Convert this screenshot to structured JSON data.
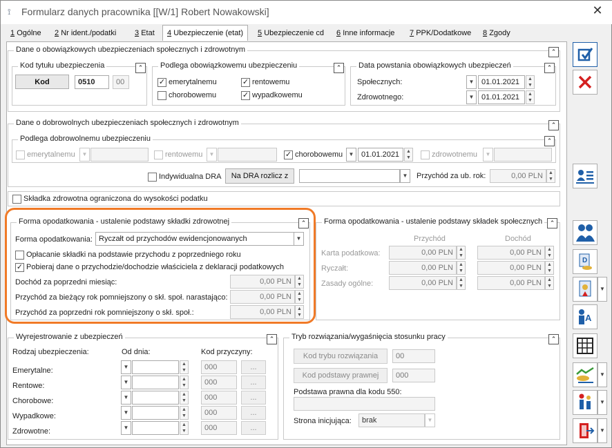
{
  "window": {
    "title": "Formularz danych pracownika [[W/1] Robert Nowakowski]",
    "app_icon": "app-icon",
    "close": "✕"
  },
  "tabs": [
    {
      "num": "1",
      "label": "Ogólne"
    },
    {
      "num": "2",
      "label": "Nr ident./podatki"
    },
    {
      "num": "3",
      "label": "Etat"
    },
    {
      "num": "4",
      "label": "Ubezpieczenie (etat)"
    },
    {
      "num": "5",
      "label": "Ubezpieczenie cd"
    },
    {
      "num": "6",
      "label": "Inne informacje"
    },
    {
      "num": "7",
      "label": "PPK/Dodatkowe"
    },
    {
      "num": "8",
      "label": "Zgody"
    }
  ],
  "mandatory": {
    "legend": "Dane o obowiązkowych ubezpieczeniach społecznych i zdrowotnym",
    "kod": {
      "legend": "Kod tytułu ubezpieczenia",
      "button": "Kod",
      "value": "0510",
      "suffix": "00"
    },
    "podlega": {
      "legend": "Podlega obowiązkowemu ubezpieczeniu",
      "items": [
        {
          "label": "emerytalnemu",
          "checked": "✓"
        },
        {
          "label": "rentowemu",
          "checked": "✓"
        },
        {
          "label": "chorobowemu",
          "checked": ""
        },
        {
          "label": "wypadkowemu",
          "checked": "✓"
        }
      ]
    },
    "data": {
      "legend": "Data powstania obowiązkowych ubezpieczeń",
      "spol_label": "Społecznych:",
      "spol_value": "01.01.2021",
      "zdr_label": "Zdrowotnego:",
      "zdr_value": "01.01.2021"
    }
  },
  "voluntary": {
    "legend": "Dane o dobrowolnych ubezpieczeniach społecznych i zdrowotnym",
    "sub_legend": "Podlega dobrowolnemu ubezpieczeniu",
    "emer": "emerytalnemu",
    "rent": "rentowemu",
    "chor": "chorobowemu",
    "chor_checked": "✓",
    "chor_date": "01.01.2021",
    "zdrow": "zdrowotnemu",
    "indyw": "Indywidualna DRA",
    "dra_button": "Na DRA rozlicz z",
    "przychod_label": "Przychód za ub. rok:",
    "przychod_value": "0,00 PLN"
  },
  "skladka": {
    "label": "Składka zdrowotna ograniczona do wysokości podatku"
  },
  "forma_zdr": {
    "legend": "Forma opodatkowania - ustalenie podstawy składki zdrowotnej",
    "forma_label": "Forma opodatkowania:",
    "forma_value": "Ryczałt od przychodów ewidencjonowanych",
    "opl_label": "Opłacanie składki na podstawie przychodu z poprzedniego roku",
    "opl_checked": "",
    "pob_label": "Pobieraj dane o przychodzie/dochodzie właściciela z deklaracji podatkowych",
    "pob_checked": "✓",
    "rows": [
      {
        "label": "Dochód za poprzedni miesiąc:",
        "value": "0,00 PLN"
      },
      {
        "label": "Przychód za bieżący rok pomniejszony o skł. społ. narastająco:",
        "value": "0,00 PLN"
      },
      {
        "label": "Przychód za poprzedni rok pomniejszony o skł. społ.:",
        "value": "0,00 PLN"
      }
    ]
  },
  "forma_spol": {
    "legend": "Forma opodatkowania - ustalenie podstawy składek społecznych",
    "col1": "Przychód",
    "col2": "Dochód",
    "rows": [
      {
        "label": "Karta podatkowa:",
        "v1": "0,00 PLN",
        "v2": "0,00 PLN"
      },
      {
        "label": "Ryczałt:",
        "v1": "0,00 PLN",
        "v2": "0,00 PLN"
      },
      {
        "label": "Zasady ogólne:",
        "v1": "0,00 PLN",
        "v2": "0,00 PLN"
      }
    ]
  },
  "wyrej": {
    "legend": "Wyrejestrowanie z ubezpieczeń",
    "h1": "Rodzaj ubezpieczenia:",
    "h2": "Od dnia:",
    "h3": "Kod przyczyny:",
    "rows": [
      {
        "label": "Emerytalne:",
        "kod": "000"
      },
      {
        "label": "Rentowe:",
        "kod": "000"
      },
      {
        "label": "Chorobowe:",
        "kod": "000"
      },
      {
        "label": "Wypadkowe:",
        "kod": "000"
      },
      {
        "label": "Zdrowotne:",
        "kod": "000"
      }
    ],
    "dots": "..."
  },
  "tryb": {
    "legend": "Tryb rozwiązania/wygaśnięcia stosunku pracy",
    "kod_tryb_btn": "Kod trybu rozwiązania",
    "kod_tryb_val": "00",
    "kod_podst_btn": "Kod podstawy prawnej",
    "kod_podst_val": "000",
    "podstawa_label": "Podstawa prawna dla kodu 550:",
    "strona_label": "Strona inicjująca:",
    "strona_value": "brak"
  },
  "colors": {
    "accent": "#f07a27",
    "save": "#1f5fa8",
    "cancel": "#d42020"
  }
}
